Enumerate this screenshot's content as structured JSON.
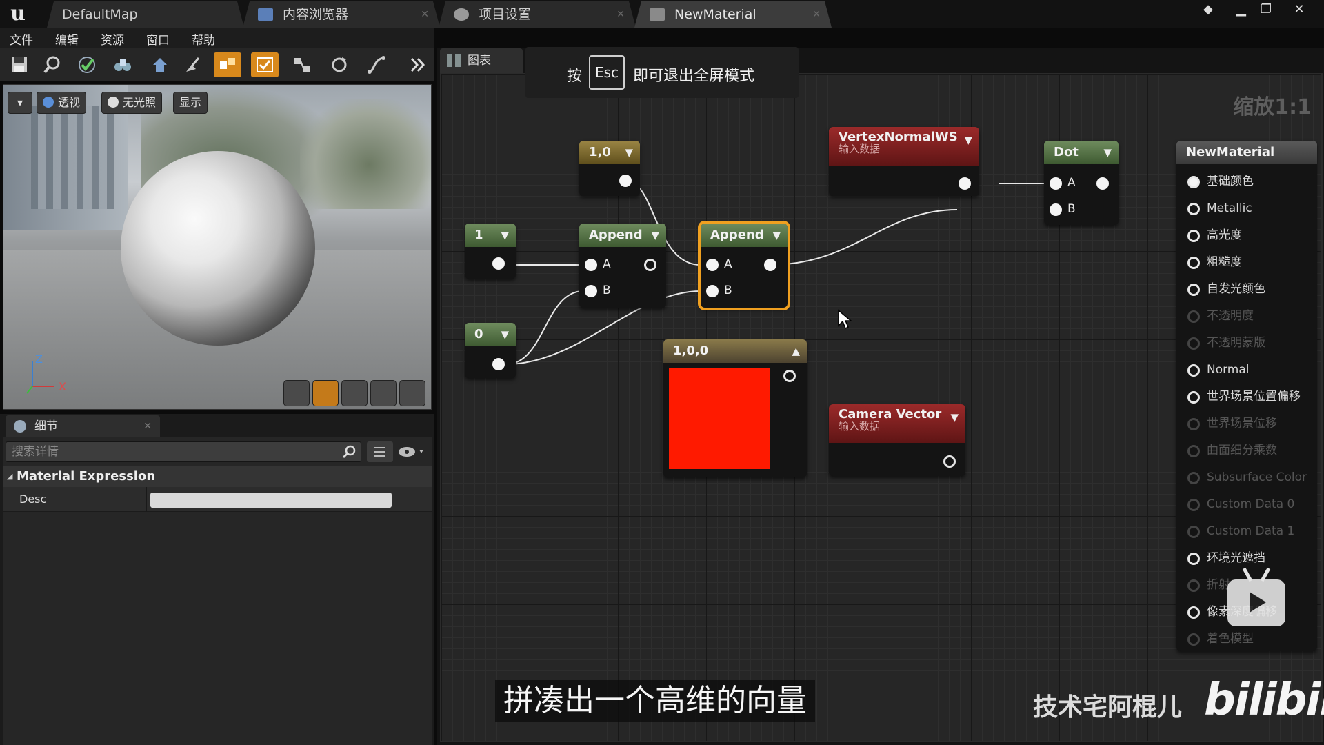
{
  "tabs": [
    {
      "label": "DefaultMap"
    },
    {
      "label": "内容浏览器"
    },
    {
      "label": "项目设置"
    },
    {
      "label": "NewMaterial"
    }
  ],
  "menu": [
    "文件",
    "编辑",
    "资源",
    "窗口",
    "帮助"
  ],
  "viewport": {
    "perspective_label": "透视",
    "lighting_label": "无光照",
    "show_label": "显示",
    "axis_z": "Z",
    "axis_x": "X"
  },
  "details": {
    "tab_label": "细节",
    "search_placeholder": "搜索详情",
    "category": "Material Expression",
    "prop_name": "Desc",
    "prop_value": ""
  },
  "graph": {
    "tab_label": "图表",
    "zoom": "缩放1:1",
    "esc_hint": {
      "before": "按",
      "key": "Esc",
      "after": "即可退出全屏模式"
    }
  },
  "nodes": {
    "const2_top": {
      "title": "1,0"
    },
    "const_1": {
      "title": "1"
    },
    "const_0": {
      "title": "0"
    },
    "append1": {
      "title": "Append",
      "pin_a": "A",
      "pin_b": "B"
    },
    "append2": {
      "title": "Append",
      "pin_a": "A",
      "pin_b": "B"
    },
    "vertex_normal": {
      "title": "VertexNormalWS",
      "sub": "输入数据"
    },
    "camera_vector": {
      "title": "Camera Vector",
      "sub": "输入数据"
    },
    "const3": {
      "title": "1,0,0",
      "color": "#ff1a00"
    },
    "dot": {
      "title": "Dot",
      "pin_a": "A",
      "pin_b": "B"
    },
    "result": {
      "title": "NewMaterial",
      "inputs": [
        {
          "label": "基础颜色",
          "state": "connected"
        },
        {
          "label": "Metallic",
          "state": "active"
        },
        {
          "label": "高光度",
          "state": "active"
        },
        {
          "label": "粗糙度",
          "state": "active"
        },
        {
          "label": "自发光颜色",
          "state": "active"
        },
        {
          "label": "不透明度",
          "state": "disabled"
        },
        {
          "label": "不透明蒙版",
          "state": "disabled"
        },
        {
          "label": "Normal",
          "state": "active"
        },
        {
          "label": "世界场景位置偏移",
          "state": "active"
        },
        {
          "label": "世界场景位移",
          "state": "disabled"
        },
        {
          "label": "曲面细分乘数",
          "state": "disabled"
        },
        {
          "label": "Subsurface Color",
          "state": "disabled"
        },
        {
          "label": "Custom Data 0",
          "state": "disabled"
        },
        {
          "label": "Custom Data 1",
          "state": "disabled"
        },
        {
          "label": "环境光遮挡",
          "state": "active"
        },
        {
          "label": "折射",
          "state": "disabled"
        },
        {
          "label": "像素深度偏移",
          "state": "active"
        },
        {
          "label": "着色模型",
          "state": "disabled"
        }
      ]
    }
  },
  "overlay": {
    "subtitle": "拼凑出一个高维的向量",
    "watermark": "技术宅阿棍儿",
    "site_logo": "bilibili"
  },
  "colors": {
    "accent": "#d8891c",
    "selection": "#f0a020",
    "swatch": "#ff1a00"
  }
}
